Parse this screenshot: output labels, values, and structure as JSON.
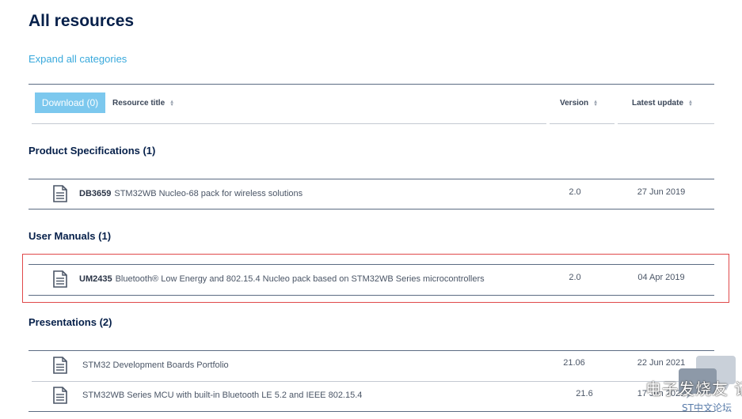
{
  "page": {
    "title": "All resources",
    "expand_link": "Expand all categories"
  },
  "table_header": {
    "download_label": "Download (0)",
    "col_title": "Resource title",
    "col_version": "Version",
    "col_update": "Latest update"
  },
  "sections": [
    {
      "title": "Product Specifications (1)",
      "rows": [
        {
          "code": "DB3659",
          "title": "STM32WB Nucleo-68 pack for wireless solutions",
          "version": "2.0",
          "date": "27 Jun 2019"
        }
      ]
    },
    {
      "title": "User Manuals (1)",
      "rows": [
        {
          "code": "UM2435",
          "title": "Bluetooth® Low Energy and 802.15.4 Nucleo pack based on STM32WB Series microcontrollers",
          "version": "2.0",
          "date": "04 Apr 2019"
        }
      ]
    },
    {
      "title": "Presentations (2)",
      "rows": [
        {
          "code": "",
          "title": "STM32 Development Boards Portfolio",
          "version": "21.06",
          "date": "22 Jun 2021"
        },
        {
          "code": "",
          "title": "STM32WB Series MCU with built-in Bluetooth LE 5.2 and IEEE 802.15.4",
          "version": "21.6",
          "date": "17 Jun 2021"
        }
      ]
    }
  ],
  "icons": {
    "document": "document-icon",
    "sort": "sort-icon",
    "chat": "chat-bubble-icon"
  },
  "watermark": {
    "text": "电子发烧友 记帖",
    "sub": "ST中文论坛"
  },
  "colors": {
    "accent": "#39a9dc",
    "button": "#7cc8ee",
    "heading": "#06204a",
    "highlight": "#e0494a"
  }
}
